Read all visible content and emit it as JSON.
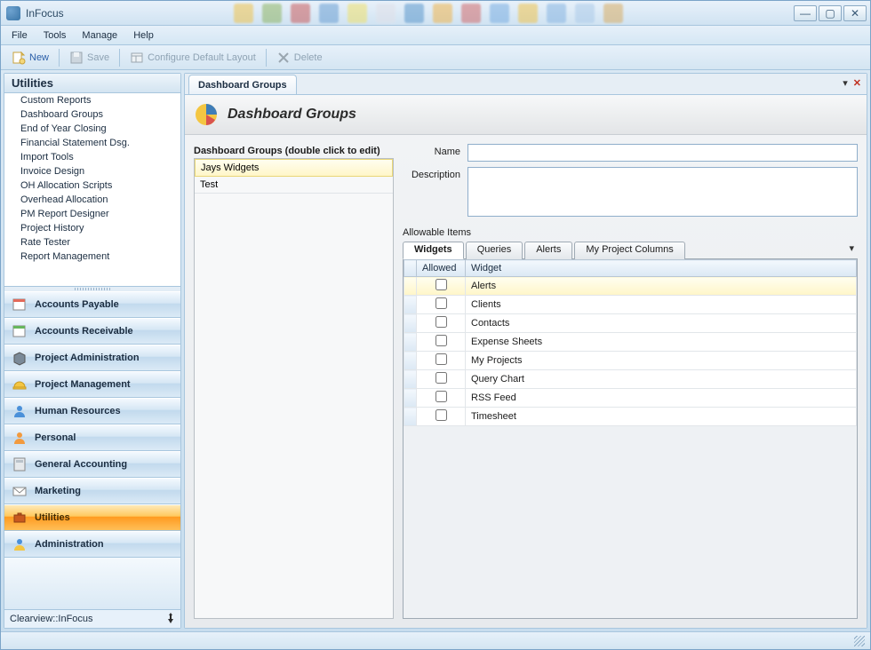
{
  "window": {
    "title": "InFocus"
  },
  "menubar": [
    "File",
    "Tools",
    "Manage",
    "Help"
  ],
  "toolbar": {
    "new": "New",
    "save": "Save",
    "configure": "Configure Default Layout",
    "delete": "Delete"
  },
  "sidebar": {
    "header": "Utilities",
    "items": [
      "Custom Reports",
      "Dashboard Groups",
      "End of Year Closing",
      "Financial Statement Dsg.",
      "Import Tools",
      "Invoice Design",
      "OH Allocation Scripts",
      "Overhead Allocation",
      "PM Report Designer",
      "Project History",
      "Rate Tester",
      "Report Management"
    ],
    "nav": [
      {
        "label": "Accounts Payable",
        "active": false
      },
      {
        "label": "Accounts Receivable",
        "active": false
      },
      {
        "label": "Project Administration",
        "active": false
      },
      {
        "label": "Project Management",
        "active": false
      },
      {
        "label": "Human Resources",
        "active": false
      },
      {
        "label": "Personal",
        "active": false
      },
      {
        "label": "General Accounting",
        "active": false
      },
      {
        "label": "Marketing",
        "active": false
      },
      {
        "label": "Utilities",
        "active": true
      },
      {
        "label": "Administration",
        "active": false
      }
    ],
    "footer": "Clearview::InFocus"
  },
  "doc": {
    "tab": "Dashboard Groups",
    "title": "Dashboard Groups"
  },
  "grouplist": {
    "label": "Dashboard Groups (double click to edit)",
    "rows": [
      "Jays Widgets",
      "Test"
    ]
  },
  "form": {
    "name_label": "Name",
    "name_value": "",
    "desc_label": "Description",
    "desc_value": ""
  },
  "allowable": {
    "label": "Allowable Items",
    "tabs": [
      "Widgets",
      "Queries",
      "Alerts",
      "My Project Columns"
    ],
    "columns": [
      "Allowed",
      "Widget"
    ],
    "rows": [
      "Alerts",
      "Clients",
      "Contacts",
      "Expense Sheets",
      "My Projects",
      "Query Chart",
      "RSS Feed",
      "Timesheet"
    ]
  }
}
